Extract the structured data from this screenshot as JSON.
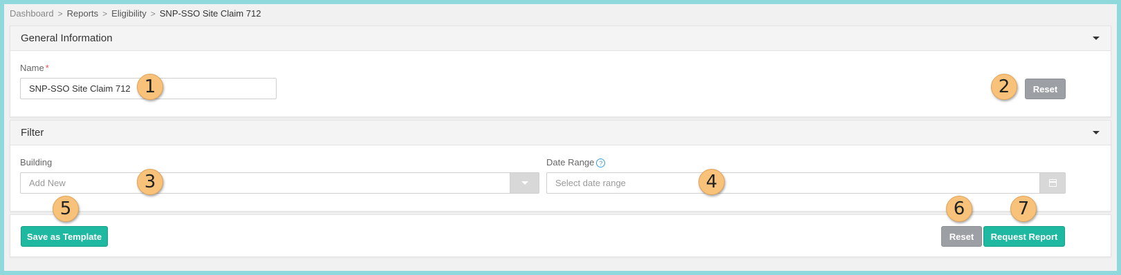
{
  "breadcrumb": {
    "items": [
      "Dashboard",
      "Reports",
      "Eligibility"
    ],
    "current": "SNP-SSO Site Claim 712",
    "separator": ">"
  },
  "general": {
    "title": "General Information",
    "name_label": "Name",
    "required_mark": "*",
    "name_value": "SNP-SSO Site Claim 712",
    "reset_label": "Reset"
  },
  "filter": {
    "title": "Filter",
    "building_label": "Building",
    "building_placeholder": "Add New",
    "date_label": "Date Range",
    "help_glyph": "?",
    "date_placeholder": "Select date range"
  },
  "footer": {
    "save_template_label": "Save as Template",
    "reset_label": "Reset",
    "request_label": "Request Report"
  },
  "badges": [
    "1",
    "2",
    "3",
    "4",
    "5",
    "6",
    "7"
  ],
  "colors": {
    "background": "#8fd9dd",
    "teal_button": "#1fb8a0",
    "gray_button": "#9ca0a4",
    "badge": "#f8c27a"
  }
}
